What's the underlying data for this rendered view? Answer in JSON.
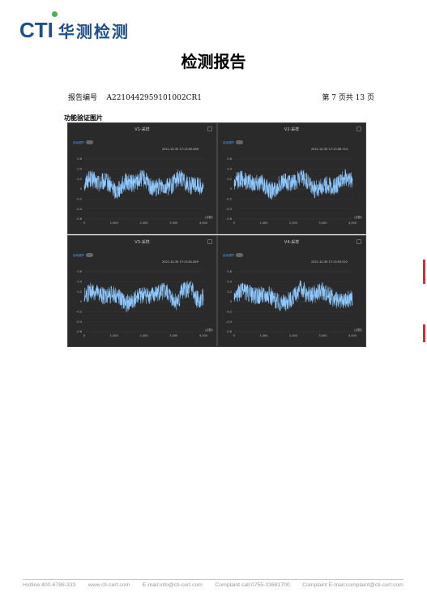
{
  "header": {
    "logo_latin": "CTI",
    "logo_chinese": "华测检测",
    "title": "检测报告"
  },
  "report": {
    "number_label": "报告编号",
    "number": "A2210442959101002CR1",
    "page_info": "第 7 页共 13 页"
  },
  "section": {
    "label": "功能验证图片"
  },
  "charts": [
    {
      "title": "V1-采样",
      "toggle_label": "自动调节",
      "timestamp": "2021-10-30 17:13:05.849"
    },
    {
      "title": "V2-采样",
      "toggle_label": "自动调节",
      "timestamp": "2021-10-30 17:13:06.724"
    },
    {
      "title": "V3-采样",
      "toggle_label": "自动调节",
      "timestamp": "2021-10-30 17:13:02.829"
    },
    {
      "title": "V4-采样",
      "toggle_label": "自动调节",
      "timestamp": "2021-10-30 17:13:03.022"
    }
  ],
  "chart_data": [
    {
      "type": "line",
      "title": "V1-采样",
      "x_ticks": [
        "0",
        "1,000",
        "2,000",
        "3,000",
        "4,000"
      ],
      "x_unit": "(点数)",
      "y_ticks": [
        "0.6",
        "0.4",
        "0.2",
        "0",
        "-0.2",
        "-0.4",
        "-0.6"
      ],
      "xlim": [
        0,
        4000
      ],
      "ylim": [
        -0.6,
        0.6
      ],
      "series_color": "#8ec9ff"
    },
    {
      "type": "line",
      "title": "V2-采样",
      "x_ticks": [
        "0",
        "1,000",
        "2,000",
        "3,000",
        "4,000"
      ],
      "x_unit": "(点数)",
      "y_ticks": [
        "0.6",
        "0.4",
        "0.2",
        "0",
        "-0.2",
        "-0.4",
        "-0.6"
      ],
      "xlim": [
        0,
        4000
      ],
      "ylim": [
        -0.6,
        0.6
      ],
      "series_color": "#8ec9ff"
    },
    {
      "type": "line",
      "title": "V3-采样",
      "x_ticks": [
        "0",
        "1,000",
        "2,000",
        "3,000",
        "4,000"
      ],
      "x_unit": "(点数)",
      "y_ticks": [
        "0.6",
        "0.4",
        "0.2",
        "0",
        "-0.2",
        "-0.4",
        "-0.6"
      ],
      "xlim": [
        0,
        4000
      ],
      "ylim": [
        -0.6,
        0.6
      ],
      "series_color": "#8ec9ff"
    },
    {
      "type": "line",
      "title": "V4-采样",
      "x_ticks": [
        "0",
        "1,000",
        "2,000",
        "3,000",
        "4,000"
      ],
      "x_unit": "(点数)",
      "y_ticks": [
        "0.6",
        "0.4",
        "0.2",
        "0",
        "-0.2",
        "-0.4",
        "-0.6"
      ],
      "xlim": [
        0,
        4000
      ],
      "ylim": [
        -0.6,
        0.6
      ],
      "series_color": "#8ec9ff"
    }
  ],
  "footer": {
    "hotline": "Hotline:400-6788-333",
    "website": "www.cti-cert.com",
    "email": "E-mail:info@cti-cert.com",
    "complaint_call": "Complaint call:0755-33681700",
    "complaint_email": "Complaint E-mail:complaint@cti-cert.com"
  },
  "colors": {
    "brand_blue": "#1f4e8c",
    "brand_green": "#4caf50",
    "panel_bg": "#2a2a2a",
    "signal": "#8ec9ff",
    "stamp_red": "#c0392b"
  }
}
